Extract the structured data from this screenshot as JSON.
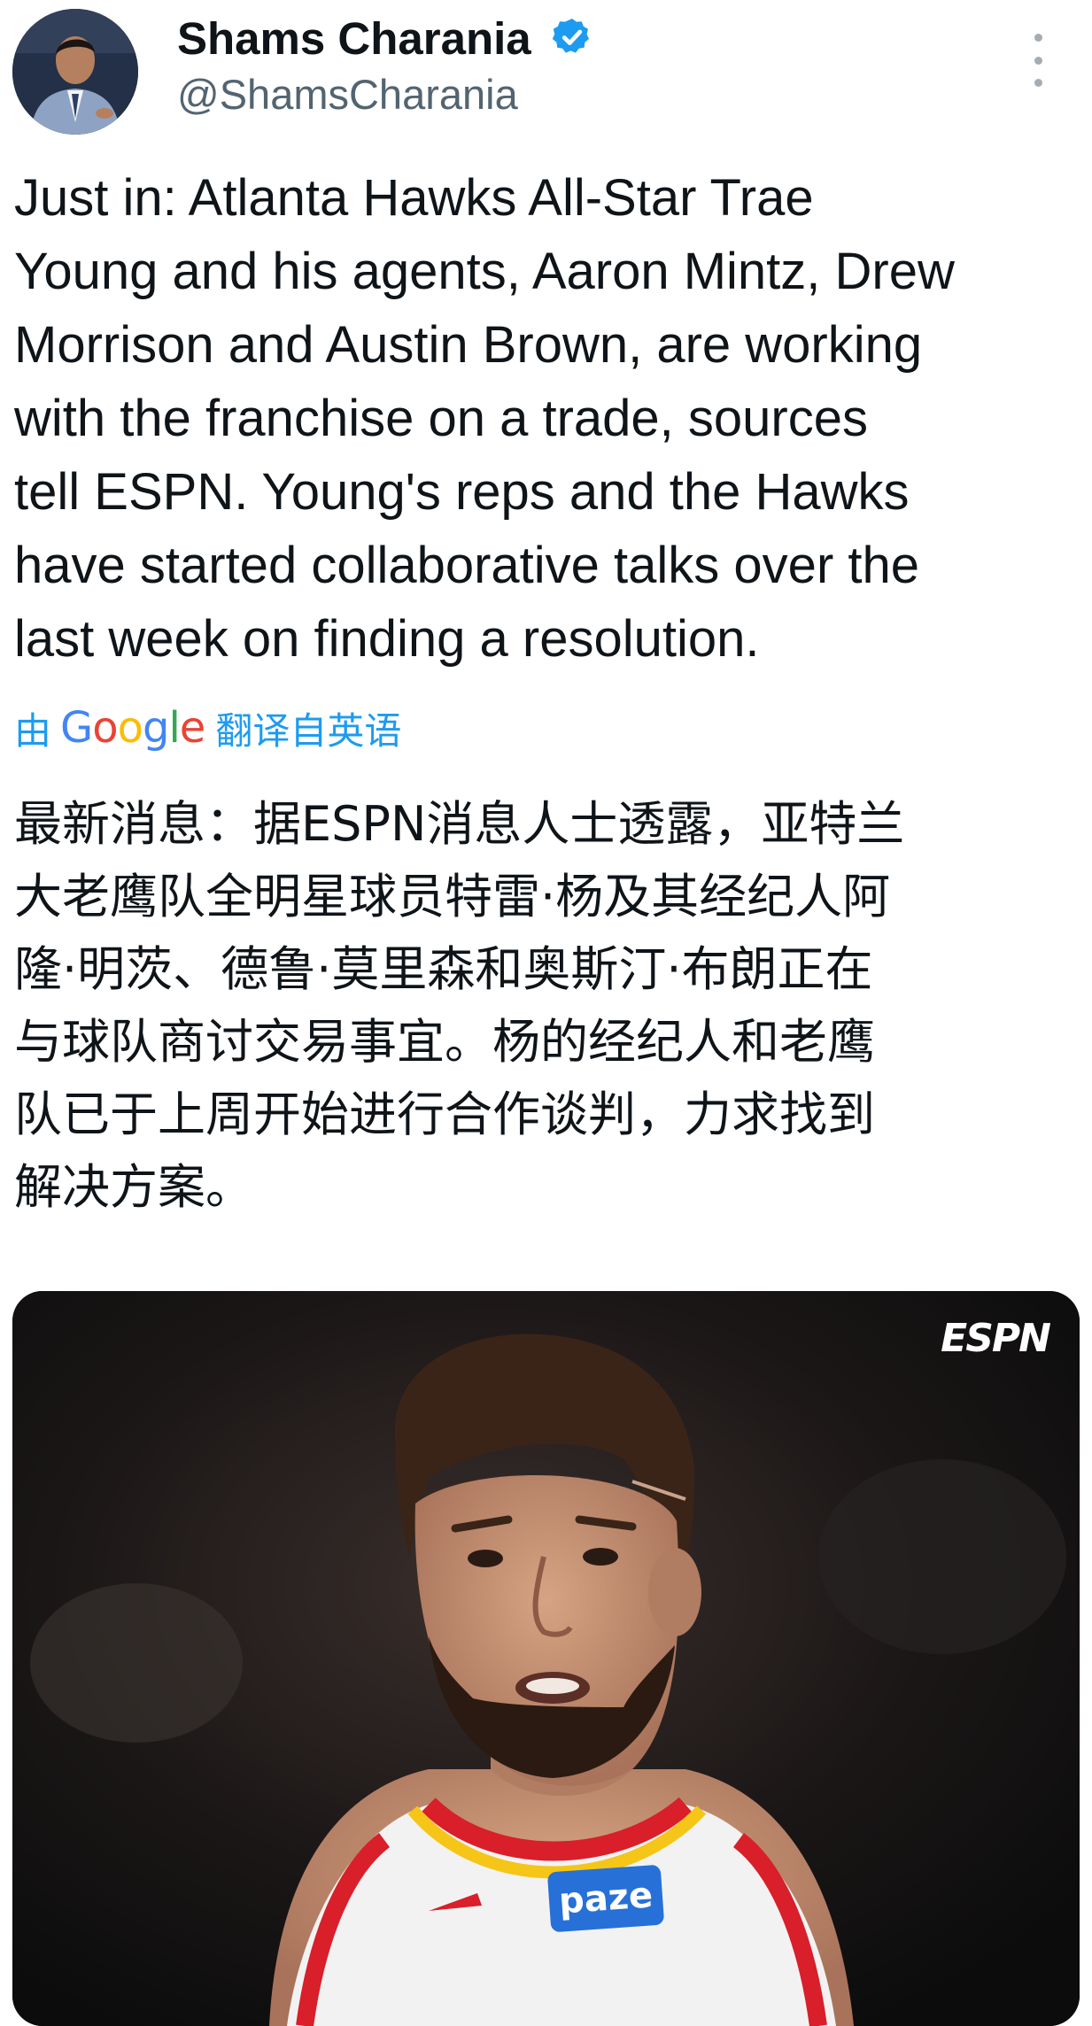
{
  "author": {
    "name": "Shams Charania",
    "handle": "@ShamsCharania",
    "verified": true,
    "verified_color": "#1d9bf0"
  },
  "tweet": {
    "text_lines": [
      "Just in: Atlanta Hawks All-Star Trae",
      "Young and his agents, Aaron Mintz, Drew",
      "Morrison and Austin Brown, are working",
      "with the franchise on a trade, sources",
      "tell ESPN. Young's reps and the Hawks",
      "have started collaborative talks over the",
      "last week on finding a resolution."
    ]
  },
  "translation": {
    "prefix": "由",
    "google_letters": [
      "G",
      "o",
      "o",
      "g",
      "l",
      "e"
    ],
    "suffix": "翻译自英语",
    "link_color": "#1d9bf0",
    "text_lines": [
      "最新消息：据ESPN消息人士透露，亚特兰",
      "大老鹰队全明星球员特雷·杨及其经纪人阿",
      "隆·明茨、德鲁·莫里森和奥斯汀·布朗正在",
      "与球队商讨交易事宜。杨的经纪人和老鹰",
      "队已于上周开始进行合作谈判，力求找到",
      "解决方案。"
    ]
  },
  "media": {
    "watermark": "ESPN",
    "jersey_text": "paze",
    "jersey_colors": {
      "base": "#f2f2f2",
      "trim_red": "#d81f2a",
      "trim_yellow": "#f5c518"
    }
  },
  "icons": {
    "verified": "verified-badge-icon",
    "more": "more-options-icon"
  }
}
